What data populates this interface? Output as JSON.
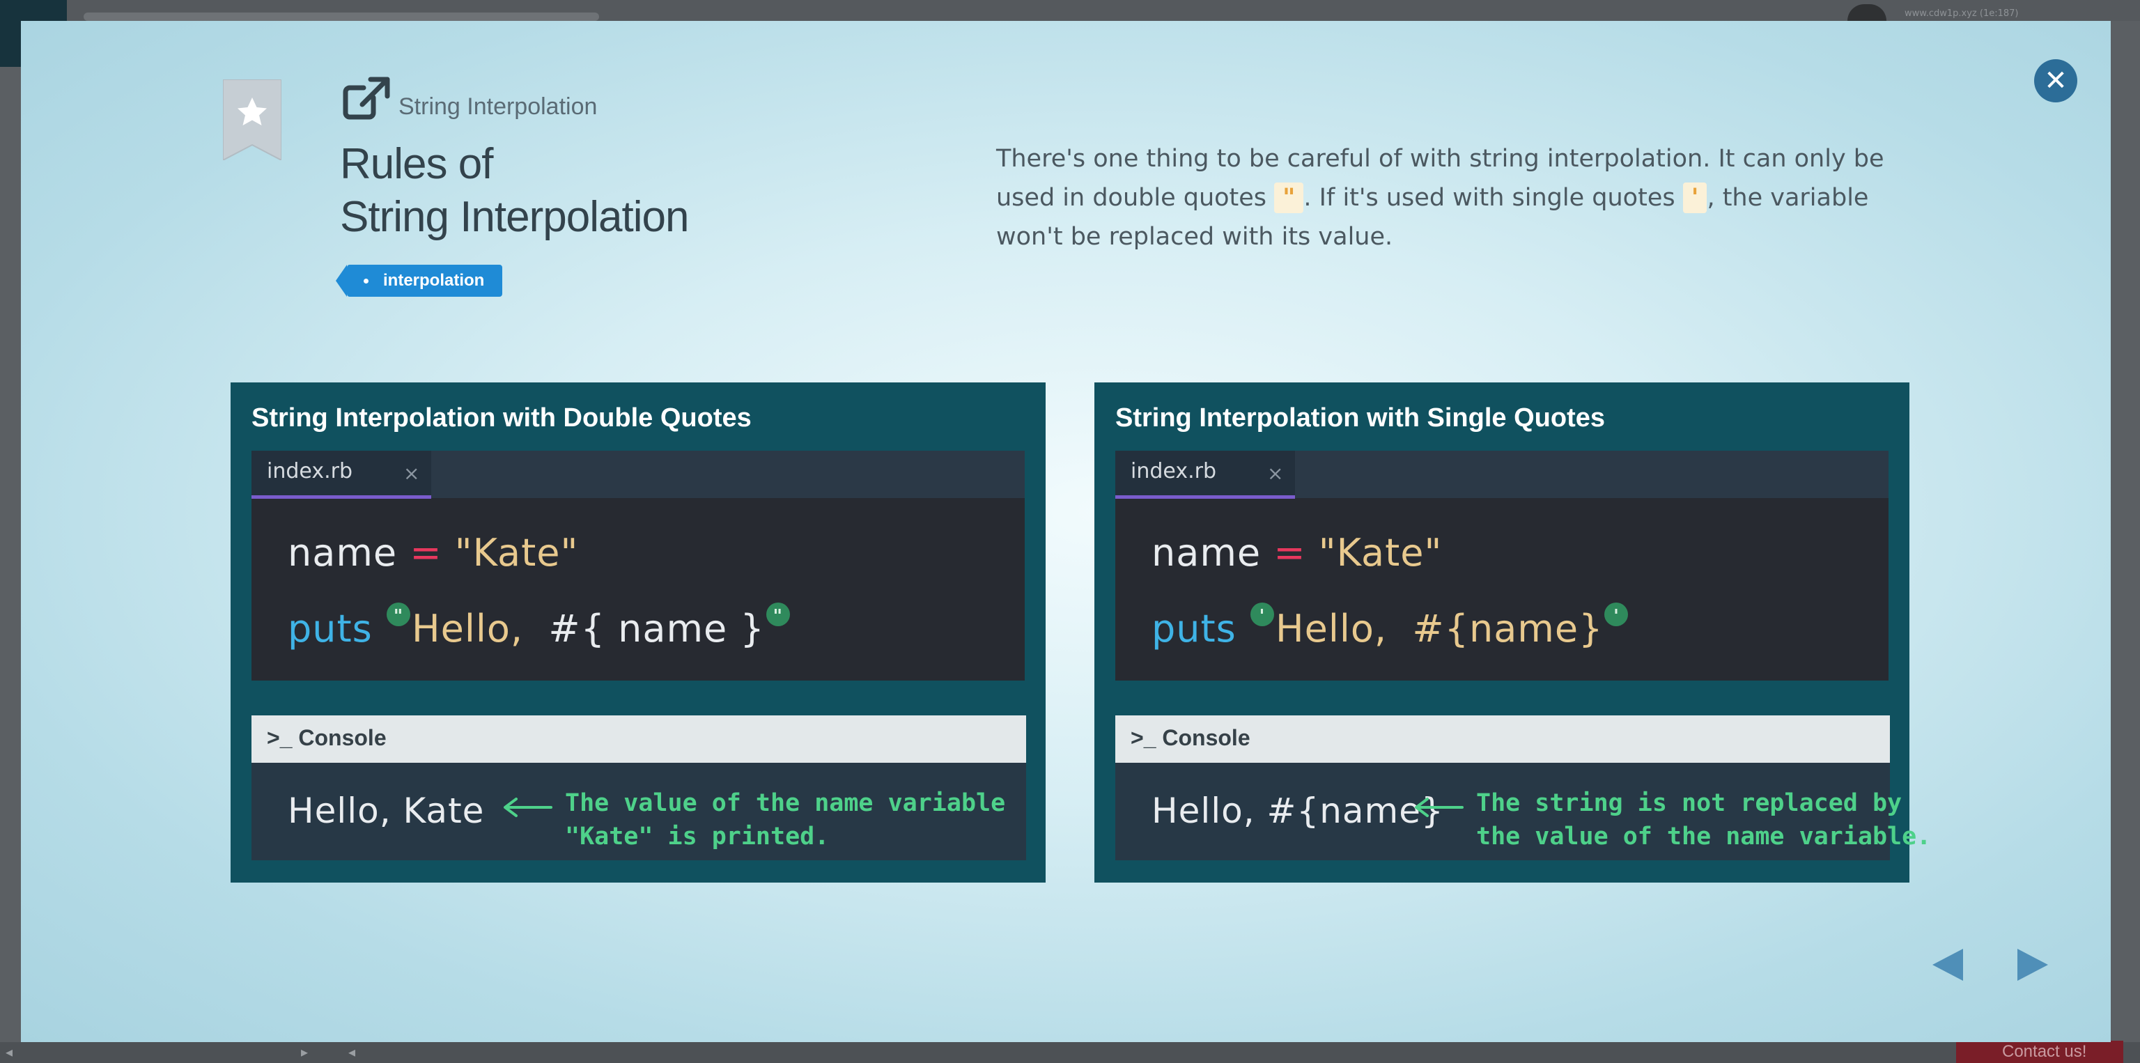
{
  "background": {
    "user_text": "www.cdw1p.xyz (1e:187)",
    "contact_label": "Contact us!"
  },
  "modal": {
    "category": "String Interpolation",
    "title_line1": "Rules of",
    "title_line2": "String Interpolation",
    "tag": "interpolation",
    "description": {
      "part1": "There's one thing to be careful of with string interpolation. It can only be used in double quotes ",
      "chip_double": "\"",
      "part2": ". If it's used with single quotes ",
      "chip_single": "'",
      "part3": ", the variable won't be replaced with its value."
    }
  },
  "slides": {
    "left": {
      "title": "String Interpolation with Double Quotes",
      "tab": "index.rb",
      "tab_close": "×",
      "code1_var": "name",
      "code1_op": "=",
      "code1_str": "\"Kate\"",
      "code2_kw": "puts",
      "code2_quote_open": "\"",
      "code2_str": "Hello,",
      "code2_interp": "#{ name }",
      "code2_quote_close": "\"",
      "console_title": "Console",
      "output": "Hello, Kate",
      "annotation": "The value of the name variable\n\"Kate\" is printed."
    },
    "right": {
      "title": "String Interpolation with Single Quotes",
      "tab": "index.rb",
      "tab_close": "×",
      "code1_var": "name",
      "code1_op": "=",
      "code1_str": "\"Kate\"",
      "code2_kw": "puts",
      "code2_quote_open": "'",
      "code2_str": "Hello,",
      "code2_interp": "#{name}",
      "code2_quote_close": "'",
      "console_title": "Console",
      "output": "Hello, #{name}",
      "annotation": "The string is not replaced by\nthe value of the name variable."
    }
  },
  "colors": {
    "slide_bg": "#10515f",
    "accent_green": "#4ed18a",
    "close_button": "#2c6d98",
    "tag": "#1f8bd6"
  }
}
